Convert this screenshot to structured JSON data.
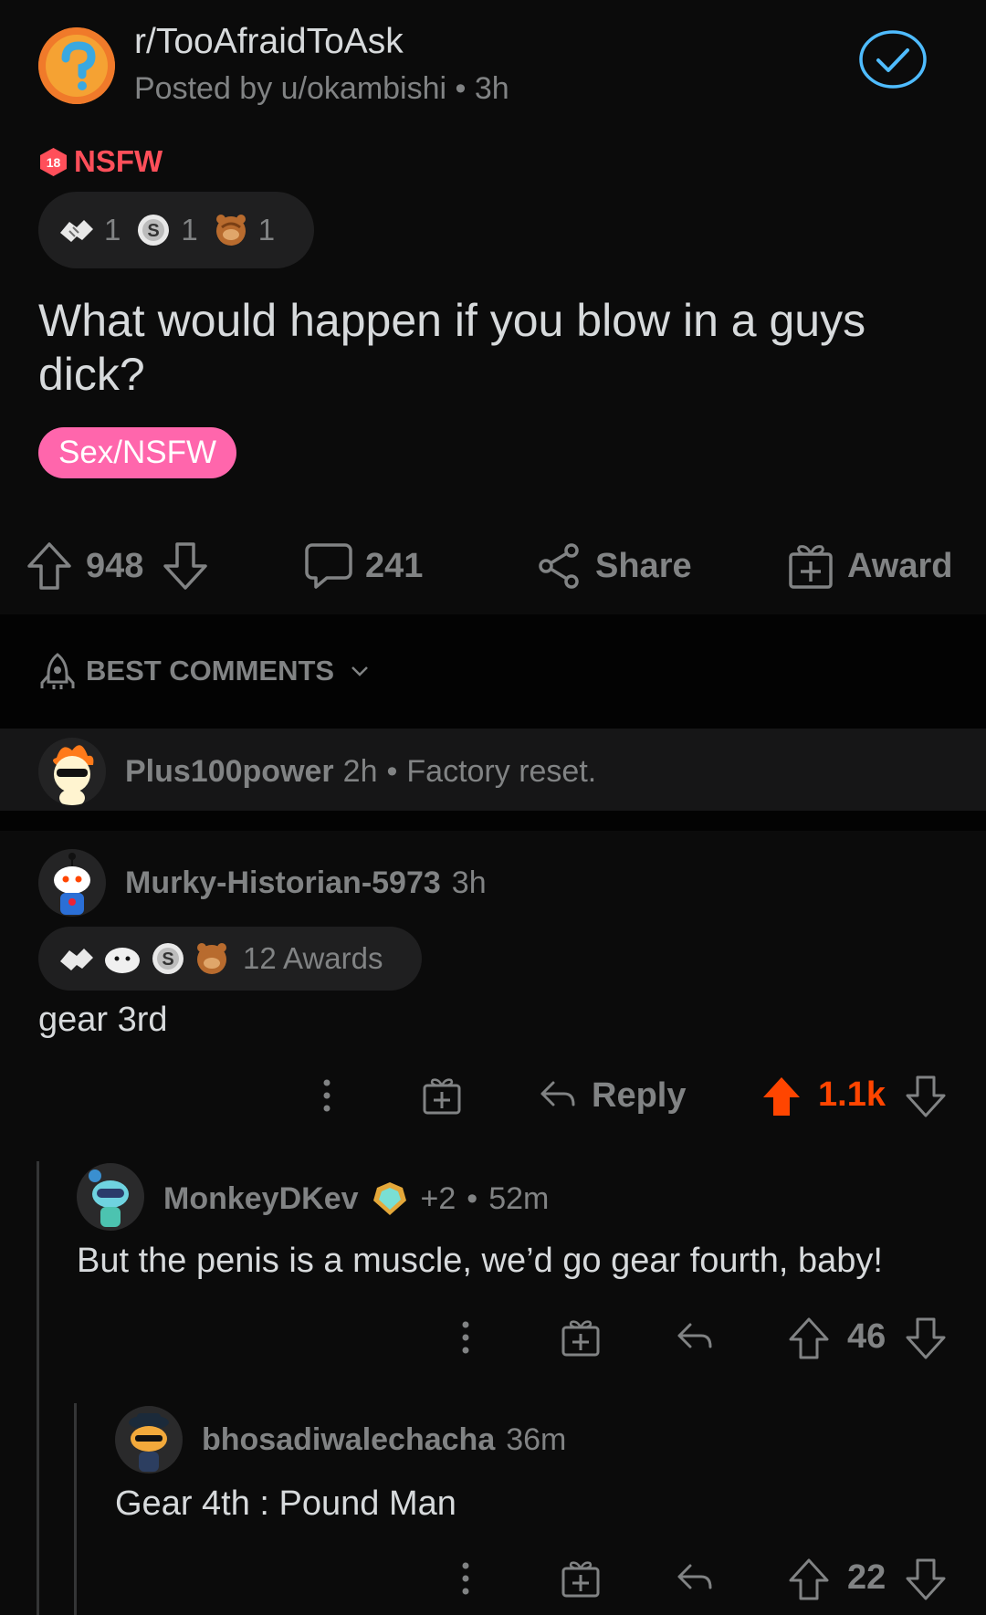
{
  "post": {
    "subreddit": "r/TooAfraidToAsk",
    "posted_by": "Posted by u/okambishi",
    "age": "3h",
    "nsfw_label": "NSFW",
    "nsfw_badge": "18",
    "awards": [
      {
        "icon": "handshake-award-icon",
        "count": "1"
      },
      {
        "icon": "silver-award-icon",
        "count": "1"
      },
      {
        "icon": "facepalm-bear-award-icon",
        "count": "1"
      }
    ],
    "title": "What would happen if you blow in a guys dick?",
    "flair": "Sex/NSFW",
    "upvotes": "948",
    "comments": "241",
    "share_label": "Share",
    "award_label": "Award"
  },
  "sort": {
    "label": "BEST COMMENTS"
  },
  "comments": [
    {
      "username": "Plus100power",
      "age": "2h",
      "collapsed_text": "Factory reset."
    },
    {
      "username": "Murky-Historian-5973",
      "age": "3h",
      "awards_label": "12 Awards",
      "body": "gear 3rd",
      "reply_label": "Reply",
      "score": "1.1k"
    },
    {
      "username": "MonkeyDKev",
      "extra_awards": "+2",
      "age": "52m",
      "body": "But the penis is a muscle, we’d go gear fourth, baby!",
      "score": "46"
    },
    {
      "username": "bhosadiwalechacha",
      "age": "36m",
      "body": "Gear 4th : Pound Man",
      "score": "22"
    }
  ],
  "colors": {
    "background": "#0b0b0b",
    "accent_blue": "#4fbcff",
    "nsfw_red": "#ff4f5a",
    "flair_pink": "#ff66ac",
    "upvote_orange": "#ff4500"
  }
}
